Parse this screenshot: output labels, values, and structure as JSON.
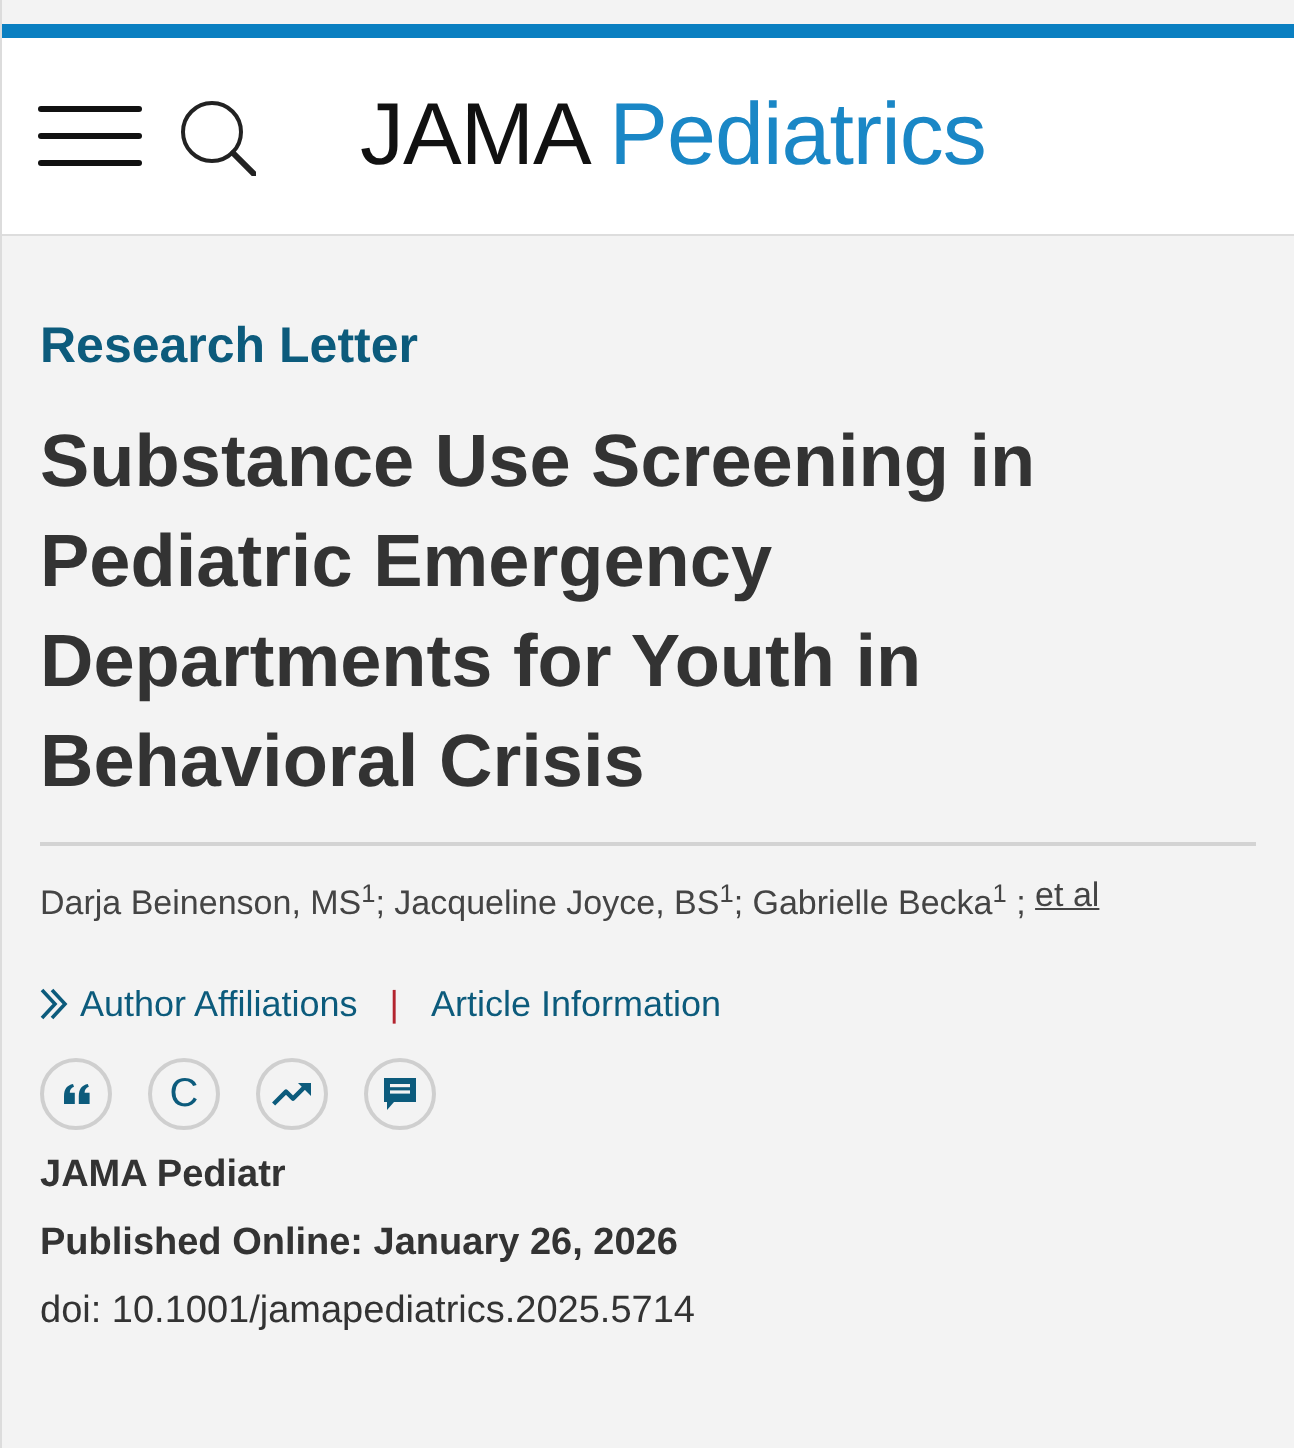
{
  "header": {
    "logo": {
      "primary": "JAMA",
      "secondary": "Pediatrics"
    }
  },
  "article": {
    "category": "Research Letter",
    "title": "Substance Use Screening in Pediatric Emergency Departments for Youth in Behavioral Crisis",
    "authors": "Darja Beinenson, MS$^{1}$; Jacqueline Joyce, BS$^{1}$; Gabrielle Becka$^{1}$ ;",
    "more_authors_link": "et al",
    "links": [
      {
        "kind": "expand",
        "label": "Author Affiliations"
      },
      {
        "kind": "plain",
        "label": "Article Information"
      }
    ],
    "link_separator": "|",
    "tools": [
      {
        "kind": "cite"
      },
      {
        "kind": "permissions",
        "label": "C"
      },
      {
        "kind": "metrics"
      },
      {
        "kind": "comments"
      }
    ],
    "journal": "JAMA Pediatr",
    "published": "Published Online: January 26, 2026",
    "doi": "doi: 10.1001/jamapediatrics.2025.5714"
  }
}
